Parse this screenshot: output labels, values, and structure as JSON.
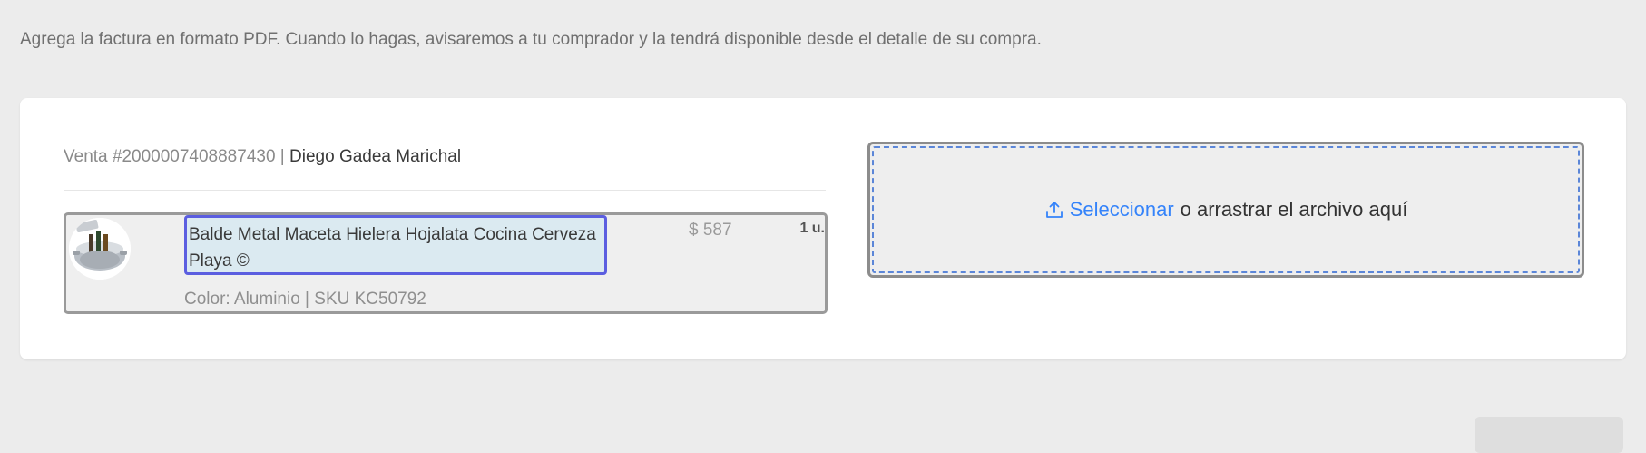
{
  "instructions": "Agrega la factura en formato PDF. Cuando lo hagas, avisaremos a tu comprador y la tendrá disponible desde el detalle de su compra.",
  "sale": {
    "label": "Venta #2000007408887430",
    "separator": " | ",
    "buyer_name": "Diego Gadea Marichal"
  },
  "item": {
    "image": "beer-bucket-product-image",
    "title": "Balde Metal Maceta Hielera Hojalata Cocina Cerveza Playa ©",
    "price": "$ 587",
    "quantity": "1 u.",
    "attributes": "Color: Aluminio | SKU KC50792"
  },
  "upload": {
    "icon": "upload-icon",
    "link_label": "Seleccionar",
    "rest_label": "o arrastrar el archivo aquí"
  },
  "colors": {
    "link": "#3483fa",
    "highlight_border": "#5b5ee0",
    "highlight_fill": "#dbeaf1",
    "dropzone_dash": "#5b86d8"
  }
}
